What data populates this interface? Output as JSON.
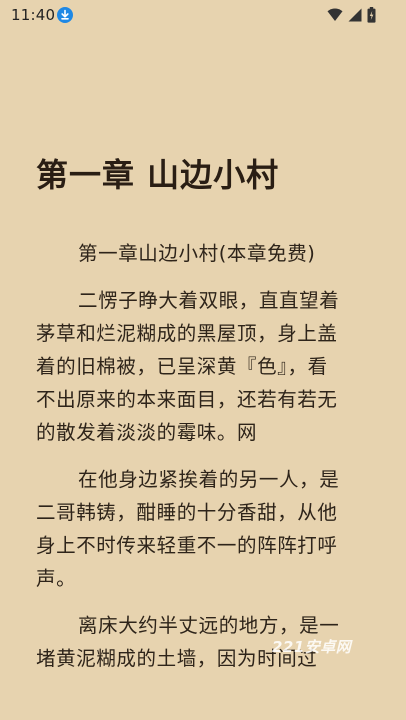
{
  "status_bar": {
    "time": "11:40",
    "icons": [
      "download-icon",
      "wifi-icon",
      "signal-icon",
      "battery-icon"
    ]
  },
  "chapter": {
    "title": "第一章 山边小村",
    "paragraphs": [
      {
        "lines": [
          "第一章山边小村(本章免费)"
        ]
      },
      {
        "lines": [
          "二愣子睁大着双眼，直直望着",
          "茅草和烂泥糊成的黑屋顶，身上盖",
          "着的旧棉被，已呈深黄『色』，看",
          "不出原来的本来面目，还若有若无",
          "的散发着淡淡的霉味。网"
        ]
      },
      {
        "lines": [
          "在他身边紧挨着的另一人，是",
          "二哥韩铸，酣睡的十分香甜，从他",
          "身上不时传来轻重不一的阵阵打呼",
          "声。"
        ]
      },
      {
        "lines": [
          "离床大约半丈远的地方，是一",
          "堵黄泥糊成的土墙，因为时间过"
        ]
      }
    ]
  },
  "watermark": "221安卓网",
  "colors": {
    "background": "#e7d3af",
    "text": "#2e241a",
    "download_badge": "#1e88e5"
  }
}
